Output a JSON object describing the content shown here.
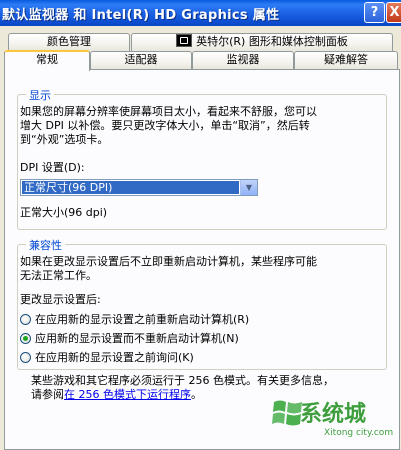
{
  "window": {
    "title": "默认监视器 和 Intel(R) HD Graphics 属性",
    "help_label": "?",
    "close_label": "X"
  },
  "tabs": {
    "row1": [
      "颜色管理",
      "英特尔(R) 图形和媒体控制面板"
    ],
    "row2": [
      "常规",
      "适配器",
      "监视器",
      "疑难解答"
    ],
    "active": "常规"
  },
  "display_group": {
    "title": "显示",
    "description_line1": "如果您的屏幕分辨率使屏幕项目太小，看起来不舒服，您可以",
    "description_line2": "增大 DPI 以补偿。要只更改字体大小，单击“取消”，然后转",
    "description_line3": "到“外观”选项卡。",
    "dpi_label": "DPI 设置(D):",
    "dpi_selected": "正常尺寸(96 DPI)",
    "dpi_note": "正常大小(96 dpi)"
  },
  "compat_group": {
    "title": "兼容性",
    "description_line1": "如果在更改显示设置后不立即重新启动计算机，某些程序可能",
    "description_line2": "无法正常工作。",
    "after_change_label": "更改显示设置后:",
    "options": [
      {
        "label": "在应用新的显示设置之前重新启动计算机(R)",
        "selected": false
      },
      {
        "label": "应用新的显示设置而不重新启动计算机(N)",
        "selected": true
      },
      {
        "label": "在应用新的显示设置之前询问(K)",
        "selected": false
      }
    ]
  },
  "footer": {
    "text_line1": "某些游戏和其它程序必须运行于 256 色模式。有关更多信息，",
    "text_prefix": "请参阅",
    "link": "在 256 色模式下运行程序",
    "text_suffix": "。"
  },
  "watermark": {
    "text": "系统城",
    "sub": "Xitong city.com"
  },
  "colors": {
    "title_bar": "#0A5AE0",
    "group_title": "#0046D5",
    "selection": "#316AC5",
    "radio_dot": "#21A121"
  }
}
